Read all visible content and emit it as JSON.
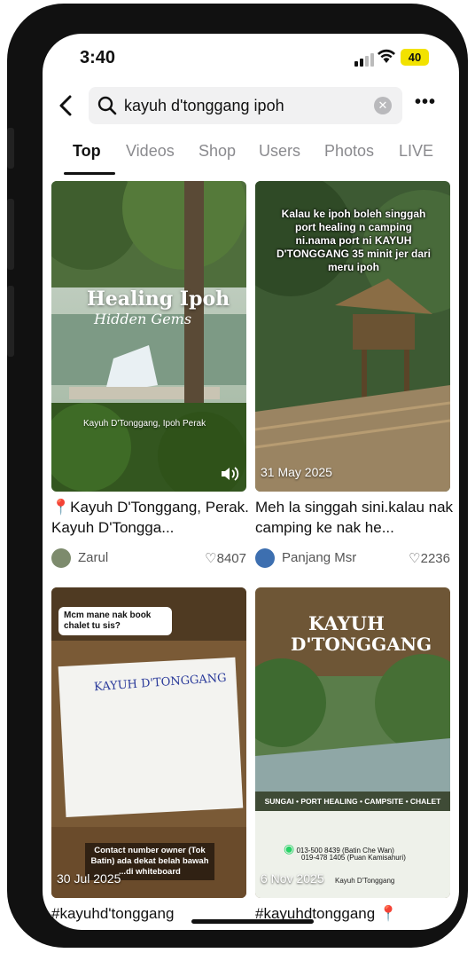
{
  "status_bar": {
    "time": "3:40",
    "battery": "40"
  },
  "search": {
    "query": "kayuh d'tonggang ipoh"
  },
  "tabs": [
    "Top",
    "Videos",
    "Shop",
    "Users",
    "Photos",
    "LIVE"
  ],
  "results": [
    {
      "thumb_title": "Healing Ipoh",
      "thumb_script": "Hidden Gems",
      "thumb_caption": "Kayuh D'Tonggang, Ipoh Perak",
      "caption": "Kayuh D'Tonggang, Perak. Kayuh D'Tongga...",
      "author": "Zarul",
      "likes": "8407"
    },
    {
      "thumb_text": "Kalau ke ipoh boleh singgah port healing n camping ni.nama port ni KAYUH D'TONGGANG 35 minit jer dari meru ipoh",
      "date": "31 May 2025",
      "caption": "Meh la singgah sini.kalau nak camping ke nak he...",
      "author": "Panjang Msr",
      "likes": "2236"
    },
    {
      "bubble": "Mcm mane nak book chalet tu sis?",
      "board_title": "KAYUH D'TONGGANG",
      "bottom_note": "Contact number owner (Tok Batin) ada dekat belah bawah ...di whiteboard",
      "date": "30 Jul 2025",
      "caption": "#kayuhd'tonggang"
    },
    {
      "poster_title_1": "KAYUH",
      "poster_title_2": "D'TONGGANG",
      "poster_tags": "SUNGAI • PORT HEALING • CAMPSITE • CHALET",
      "contact_1": "013-500 8439 (Batin Che Wan)",
      "contact_2": "019-478 1405 (Puan Kamisahuri)",
      "poster_footer": "Kayuh D'Tonggang",
      "date": "6 Nov 2025",
      "caption": "#kayuhdtonggang"
    }
  ],
  "colors": {
    "accent_battery": "#f2e200",
    "pin": "#e8313a",
    "text": "#111111",
    "muted": "#8a8a8e"
  }
}
